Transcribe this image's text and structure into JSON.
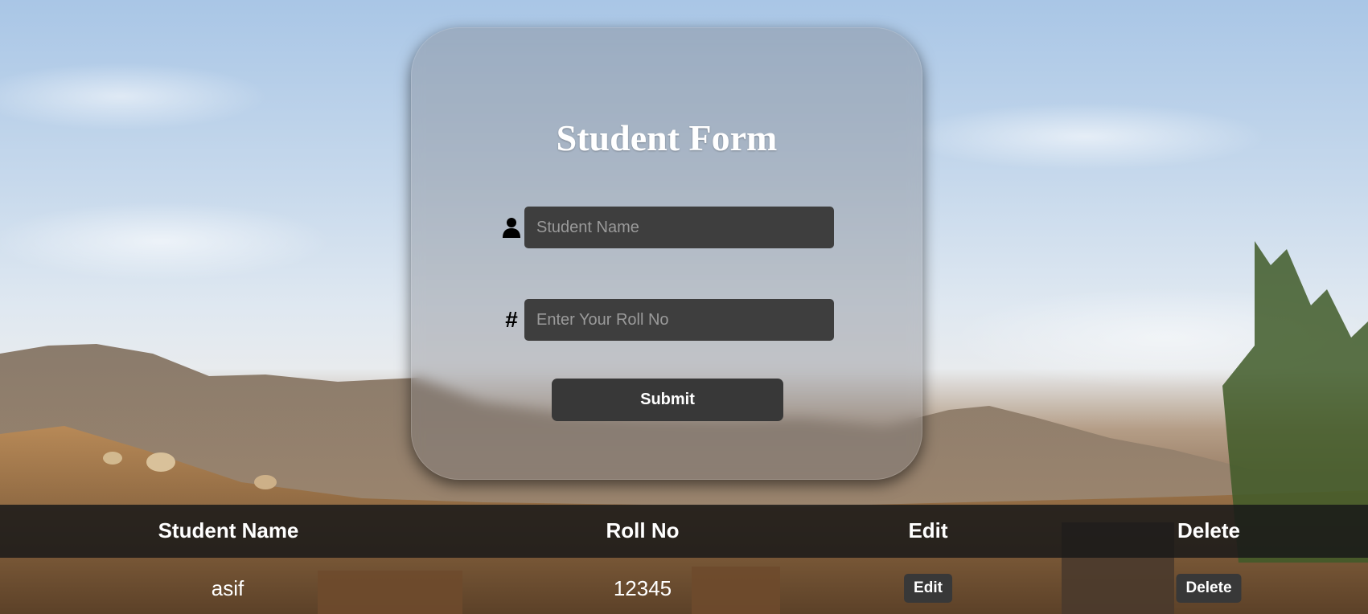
{
  "form": {
    "title": "Student Form",
    "name_placeholder": "Student Name",
    "roll_placeholder": "Enter Your Roll No",
    "name_icon": "user-icon",
    "roll_icon_glyph": "#",
    "submit_label": "Submit"
  },
  "table": {
    "headers": [
      "Student Name",
      "Roll No",
      "Edit",
      "Delete"
    ],
    "rows": [
      {
        "name": "asif",
        "roll": "12345",
        "edit_label": "Edit",
        "delete_label": "Delete"
      }
    ]
  },
  "colors": {
    "input_bg": "#3e3e3e",
    "button_bg": "#383838",
    "header_bg": "#191919"
  }
}
